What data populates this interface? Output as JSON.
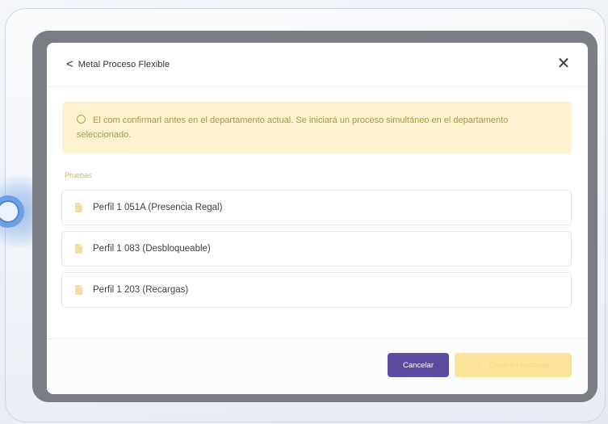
{
  "modal": {
    "back_glyph": "<",
    "title": "Metal Proceso Flexible",
    "close_glyph": "✕",
    "alert_text": "El com confirmarl antes en el departamento actual. Se iniciará un proceso simultáneo en el departamento seleccionado.",
    "section_label": "Pruebas",
    "items": [
      {
        "label": "Perfil 1 051A (Presencia Regal)"
      },
      {
        "label": "Perfil 1 083 (Desbloqueable)"
      },
      {
        "label": "Perfil 1 203 (Recargas)"
      }
    ],
    "cancel_label": "Cancelar",
    "confirm_label": "Crear en cascada"
  },
  "colors": {
    "accent_purple": "#5b4a9e",
    "warning_bg": "#fdf4cf",
    "confirm_disabled": "#fbe39a",
    "halo_blue": "#4b86d4"
  },
  "icons": [
    "back-arrow-icon",
    "close-icon",
    "info-circle-icon",
    "document-icon",
    "check-icon"
  ]
}
